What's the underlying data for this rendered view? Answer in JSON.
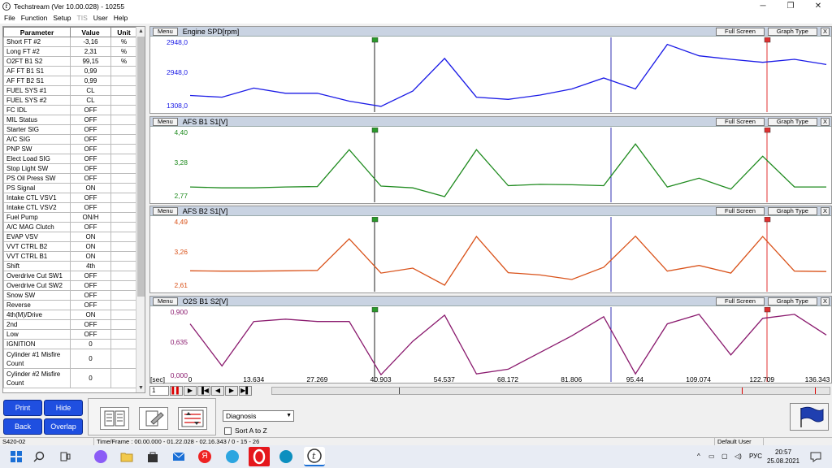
{
  "window": {
    "title": "Techstream (Ver 10.00.028) - 10255",
    "controls": [
      "─",
      "❐",
      "✕"
    ]
  },
  "menu": [
    "File",
    "Function",
    "Setup",
    "TIS",
    "User",
    "Help"
  ],
  "params": {
    "headers": [
      "Parameter",
      "Value",
      "Unit"
    ],
    "rows": [
      {
        "name": "Short FT #2",
        "value": "-3,16",
        "unit": "%"
      },
      {
        "name": "Long FT #2",
        "value": "2,31",
        "unit": "%"
      },
      {
        "name": "O2FT B1 S2",
        "value": "99,15",
        "unit": "%"
      },
      {
        "name": "AF FT B1 S1",
        "value": "0,99",
        "unit": ""
      },
      {
        "name": "AF FT B2 S1",
        "value": "0,99",
        "unit": ""
      },
      {
        "name": "FUEL SYS #1",
        "value": "CL",
        "unit": ""
      },
      {
        "name": "FUEL SYS #2",
        "value": "CL",
        "unit": ""
      },
      {
        "name": "FC IDL",
        "value": "OFF",
        "unit": ""
      },
      {
        "name": "MIL Status",
        "value": "OFF",
        "unit": ""
      },
      {
        "name": "Starter SIG",
        "value": "OFF",
        "unit": ""
      },
      {
        "name": "A/C SIG",
        "value": "OFF",
        "unit": ""
      },
      {
        "name": "PNP SW",
        "value": "OFF",
        "unit": ""
      },
      {
        "name": "Elect Load SIG",
        "value": "OFF",
        "unit": ""
      },
      {
        "name": "Stop Light SW",
        "value": "OFF",
        "unit": ""
      },
      {
        "name": "PS Oil Press SW",
        "value": "OFF",
        "unit": ""
      },
      {
        "name": "PS Signal",
        "value": "ON",
        "unit": ""
      },
      {
        "name": "Intake CTL VSV1",
        "value": "OFF",
        "unit": ""
      },
      {
        "name": "Intake CTL VSV2",
        "value": "OFF",
        "unit": ""
      },
      {
        "name": "Fuel Pump",
        "value": "ON/H",
        "unit": ""
      },
      {
        "name": "A/C MAG Clutch",
        "value": "OFF",
        "unit": ""
      },
      {
        "name": "EVAP VSV",
        "value": "ON",
        "unit": ""
      },
      {
        "name": "VVT CTRL B2",
        "value": "ON",
        "unit": ""
      },
      {
        "name": "VVT CTRL B1",
        "value": "ON",
        "unit": ""
      },
      {
        "name": "Shift",
        "value": "4th",
        "unit": ""
      },
      {
        "name": "Overdrive Cut SW1",
        "value": "OFF",
        "unit": ""
      },
      {
        "name": "Overdrive Cut SW2",
        "value": "OFF",
        "unit": ""
      },
      {
        "name": "Snow SW",
        "value": "OFF",
        "unit": ""
      },
      {
        "name": "Reverse",
        "value": "OFF",
        "unit": ""
      },
      {
        "name": "4th(M)/Drive",
        "value": "ON",
        "unit": ""
      },
      {
        "name": "2nd",
        "value": "OFF",
        "unit": ""
      },
      {
        "name": "Low",
        "value": "OFF",
        "unit": ""
      },
      {
        "name": "IGNITION",
        "value": "0",
        "unit": ""
      },
      {
        "name": "Cylinder #1 Misfire Count",
        "value": "0",
        "unit": "",
        "tall": true
      },
      {
        "name": "Cylinder #2 Misfire Count",
        "value": "0",
        "unit": "",
        "tall": true
      }
    ]
  },
  "graph_buttons": {
    "menu": "Menu",
    "full_screen": "Full Screen",
    "graph_type": "Graph Type",
    "close": "X"
  },
  "chart_data": [
    {
      "type": "line",
      "title": "Engine SPD[rpm]",
      "color": "#1a1ae6",
      "axis_labels": [
        "2948,0",
        "2948,0",
        "1308,0"
      ],
      "ylim": [
        1308,
        2948
      ],
      "x": [
        0,
        6.8,
        13.6,
        20.4,
        27.3,
        34.1,
        40.9,
        47.7,
        54.5,
        61.4,
        68.2,
        75.0,
        81.8,
        88.6,
        95.4,
        102.3,
        109.1,
        115.9,
        122.7,
        129.5,
        136.3
      ],
      "values": [
        1690,
        1650,
        1860,
        1740,
        1740,
        1560,
        1440,
        1790,
        2540,
        1650,
        1600,
        1700,
        1840,
        2090,
        1840,
        2860,
        2600,
        2520,
        2450,
        2520,
        2400
      ]
    },
    {
      "type": "line",
      "title": "AFS B1 S1[V]",
      "color": "#1e8a1e",
      "axis_labels": [
        "4,40",
        "3,28",
        "2,77"
      ],
      "ylim": [
        2.77,
        4.4
      ],
      "values": [
        3.12,
        3.1,
        3.1,
        3.12,
        3.13,
        3.97,
        3.14,
        3.1,
        2.9,
        3.97,
        3.15,
        3.18,
        3.17,
        3.15,
        4.1,
        3.12,
        3.32,
        3.07,
        3.82,
        3.12,
        3.12
      ]
    },
    {
      "type": "line",
      "title": "AFS B2 S1[V]",
      "color": "#d9521a",
      "axis_labels": [
        "4,49",
        "3,26",
        "2,61"
      ],
      "ylim": [
        2.61,
        4.49
      ],
      "values": [
        3.16,
        3.15,
        3.15,
        3.16,
        3.17,
        4.0,
        3.1,
        3.23,
        2.78,
        4.06,
        3.11,
        3.05,
        2.93,
        3.25,
        4.07,
        3.15,
        3.3,
        3.1,
        4.06,
        3.15,
        3.14
      ]
    },
    {
      "type": "line",
      "title": "O2S B1 S2[V]",
      "color": "#8a1a6e",
      "axis_labels": [
        "0,900",
        "0,635",
        "0,000"
      ],
      "ylim": [
        0,
        0.9
      ],
      "values": [
        0.73,
        0.2,
        0.76,
        0.79,
        0.76,
        0.76,
        0.09,
        0.51,
        0.84,
        0.1,
        0.16,
        0.37,
        0.58,
        0.82,
        0.1,
        0.73,
        0.85,
        0.34,
        0.8,
        0.85,
        0.59
      ]
    }
  ],
  "time_axis": {
    "unit": "[sec]",
    "ticks": [
      "0",
      "13.634",
      "27.269",
      "40.903",
      "54.537",
      "68.172",
      "81.806",
      "95.44",
      "109.074",
      "122.709",
      "136.343"
    ]
  },
  "player": {
    "spin_value": "1",
    "buttons": [
      "▌▌",
      "▶",
      "▐◀",
      "◀",
      "▶",
      "▶▌"
    ]
  },
  "bottom": {
    "print": "Print",
    "hide": "Hide",
    "back": "Back",
    "overlap": "Overlap",
    "select_value": "Diagnosis",
    "sort_label": "Sort A to Z"
  },
  "status": {
    "code": "S420-02",
    "time_frame": "Time/Frame : 00.00.000 - 01.22.028 - 02.16.343 / 0 - 15 - 26",
    "user": "Default User"
  },
  "taskbar": {
    "language": "РУС",
    "time": "20:57",
    "date": "25.08.2021"
  }
}
